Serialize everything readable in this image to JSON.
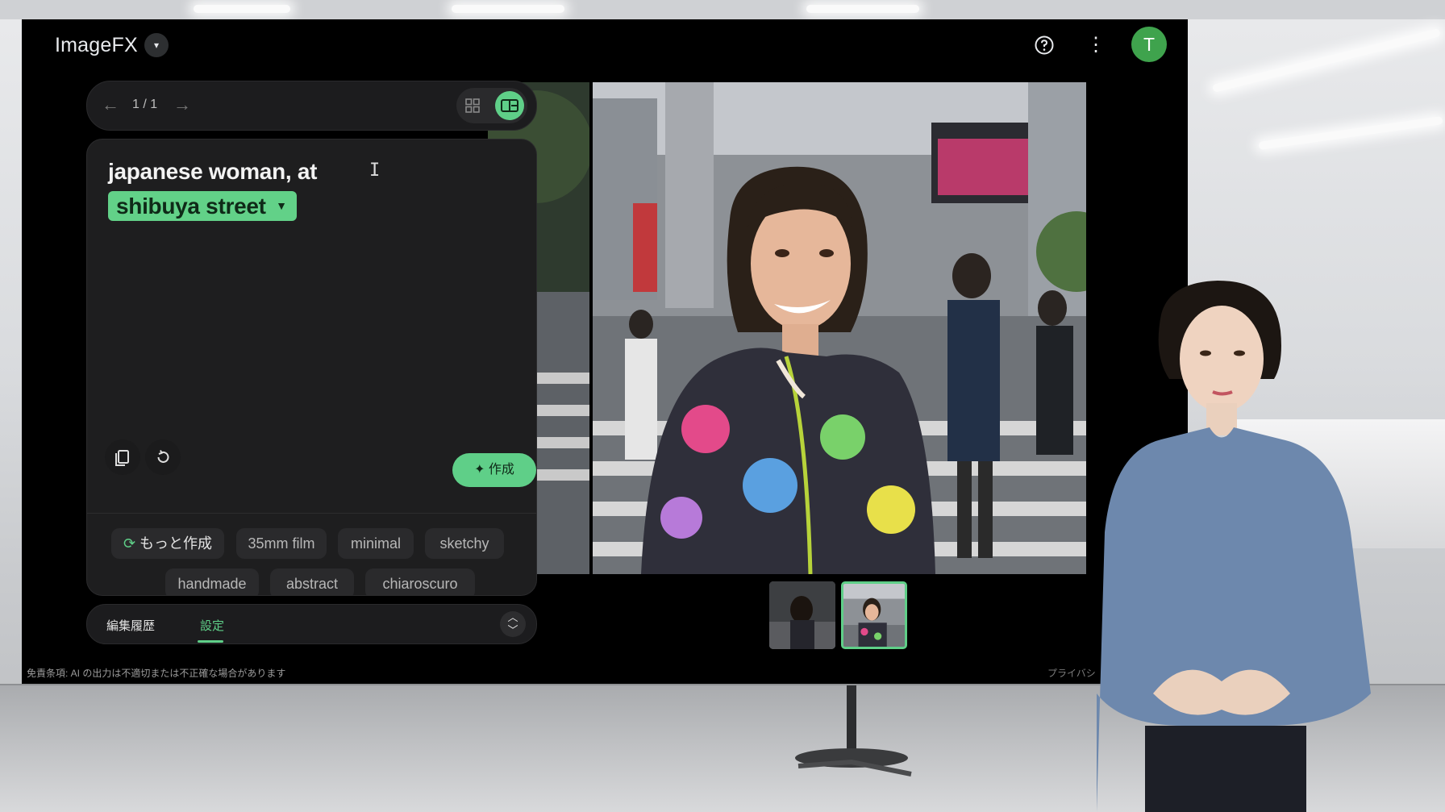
{
  "app": {
    "title": "ImageFX",
    "avatar_letter": "T",
    "brand_color": "#5fcf88",
    "avatar_color": "#3fa34d"
  },
  "header": {
    "logo_dropdown_icon": "caret-down-icon",
    "help_icon": "help-circle-icon",
    "more_icon": "more-vert-icon"
  },
  "pager": {
    "counter": "1 / 1",
    "back_icon": "arrow-left-icon",
    "forward_icon": "arrow-right-icon",
    "grid_view_icon": "grid-icon",
    "single_view_icon": "single-view-icon"
  },
  "prompt": {
    "text": "japanese woman, at",
    "chip": "shibuya street",
    "create_label": "作成",
    "copy_icon": "copy-icon",
    "reset_icon": "reset-icon"
  },
  "suggestions": {
    "more_label": "もっと作成",
    "items": [
      "35mm film",
      "minimal",
      "sketchy",
      "handmade",
      "abstract",
      "chiaroscuro"
    ]
  },
  "tabs": {
    "history": "編集履歴",
    "settings": "設定",
    "active": "settings"
  },
  "footer": {
    "disclaimer": "免責条項: AI の出力は不適切または不正確な場合があります",
    "privacy": "プライバシ"
  }
}
